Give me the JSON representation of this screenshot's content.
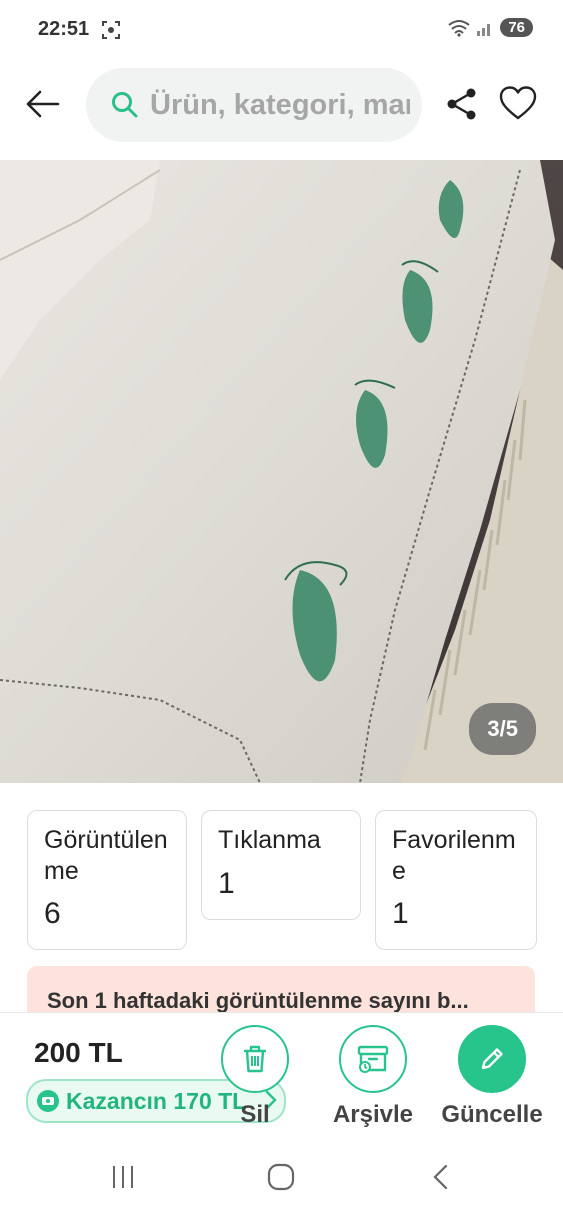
{
  "status_bar": {
    "time": "22:51",
    "battery": "76"
  },
  "header": {
    "search_placeholder": "Ürün, kategori, marka ara"
  },
  "gallery": {
    "counter": "3/5"
  },
  "stats": [
    {
      "label": "Görüntülen me",
      "value": "6"
    },
    {
      "label": "Tıklanma",
      "value": "1"
    },
    {
      "label": "Favorilenm e",
      "value": "1"
    }
  ],
  "banner": {
    "text": "Son 1 haftadaki görüntülenme sayını b..."
  },
  "bottom": {
    "price": "200 TL",
    "earn": "Kazancın 170 TL",
    "actions": {
      "delete": "Sil",
      "archive": "Arşivle",
      "update": "Güncelle"
    }
  },
  "colors": {
    "accent": "#27c48b",
    "banner_bg": "#fde3dc"
  },
  "icons": [
    "back-arrow-icon",
    "search-icon",
    "share-icon",
    "heart-icon",
    "trash-icon",
    "archive-icon",
    "pencil-icon",
    "coin-icon",
    "chevron-right-icon"
  ]
}
